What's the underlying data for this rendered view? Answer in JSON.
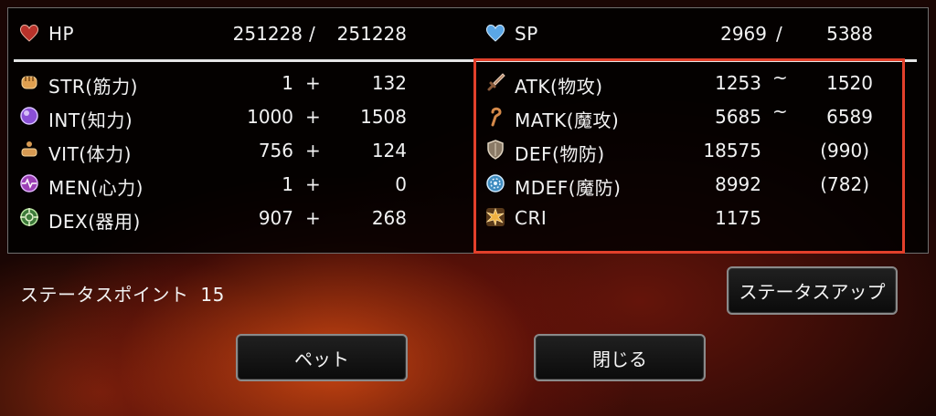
{
  "hp": {
    "label": "HP",
    "current": "251228",
    "separator": "/",
    "max": "251228",
    "icon": "heart-icon",
    "color": "#c0392b"
  },
  "sp": {
    "label": "SP",
    "current": "2969",
    "separator": "/",
    "max": "5388",
    "icon": "blue-heart-icon",
    "color": "#5aa6e6"
  },
  "base_stats": [
    {
      "label": "STR(筋力)",
      "base": "1",
      "op": "+",
      "bonus": "132",
      "icon": "fist-icon"
    },
    {
      "label": "INT(知力)",
      "base": "1000",
      "op": "+",
      "bonus": "1508",
      "icon": "orb-icon"
    },
    {
      "label": "VIT(体力)",
      "base": "756",
      "op": "+",
      "bonus": "124",
      "icon": "body-icon"
    },
    {
      "label": "MEN(心力)",
      "base": "1",
      "op": "+",
      "bonus": "0",
      "icon": "heartbeat-icon"
    },
    {
      "label": "DEX(器用)",
      "base": "907",
      "op": "+",
      "bonus": "268",
      "icon": "crosshair-icon"
    }
  ],
  "combat_stats": [
    {
      "label": "ATK(物攻)",
      "value": "1253",
      "sep": "~",
      "extra": "1520",
      "icon": "sword-icon"
    },
    {
      "label": "MATK(魔攻)",
      "value": "5685",
      "sep": "~",
      "extra": "6589",
      "icon": "staff-icon"
    },
    {
      "label": "DEF(物防)",
      "value": "18575",
      "sep": "",
      "extra": "(990)",
      "icon": "shield-icon"
    },
    {
      "label": "MDEF(魔防)",
      "value": "8992",
      "sep": "",
      "extra": "(782)",
      "icon": "magic-circle-icon"
    },
    {
      "label": "CRI",
      "value": "1175",
      "sep": "",
      "extra": "",
      "icon": "critical-burst-icon"
    }
  ],
  "status_points": {
    "label": "ステータスポイント",
    "value": "15"
  },
  "buttons": {
    "status_up": "ステータスアップ",
    "pet": "ペット",
    "close": "閉じる"
  },
  "highlight_color": "#e2402b"
}
